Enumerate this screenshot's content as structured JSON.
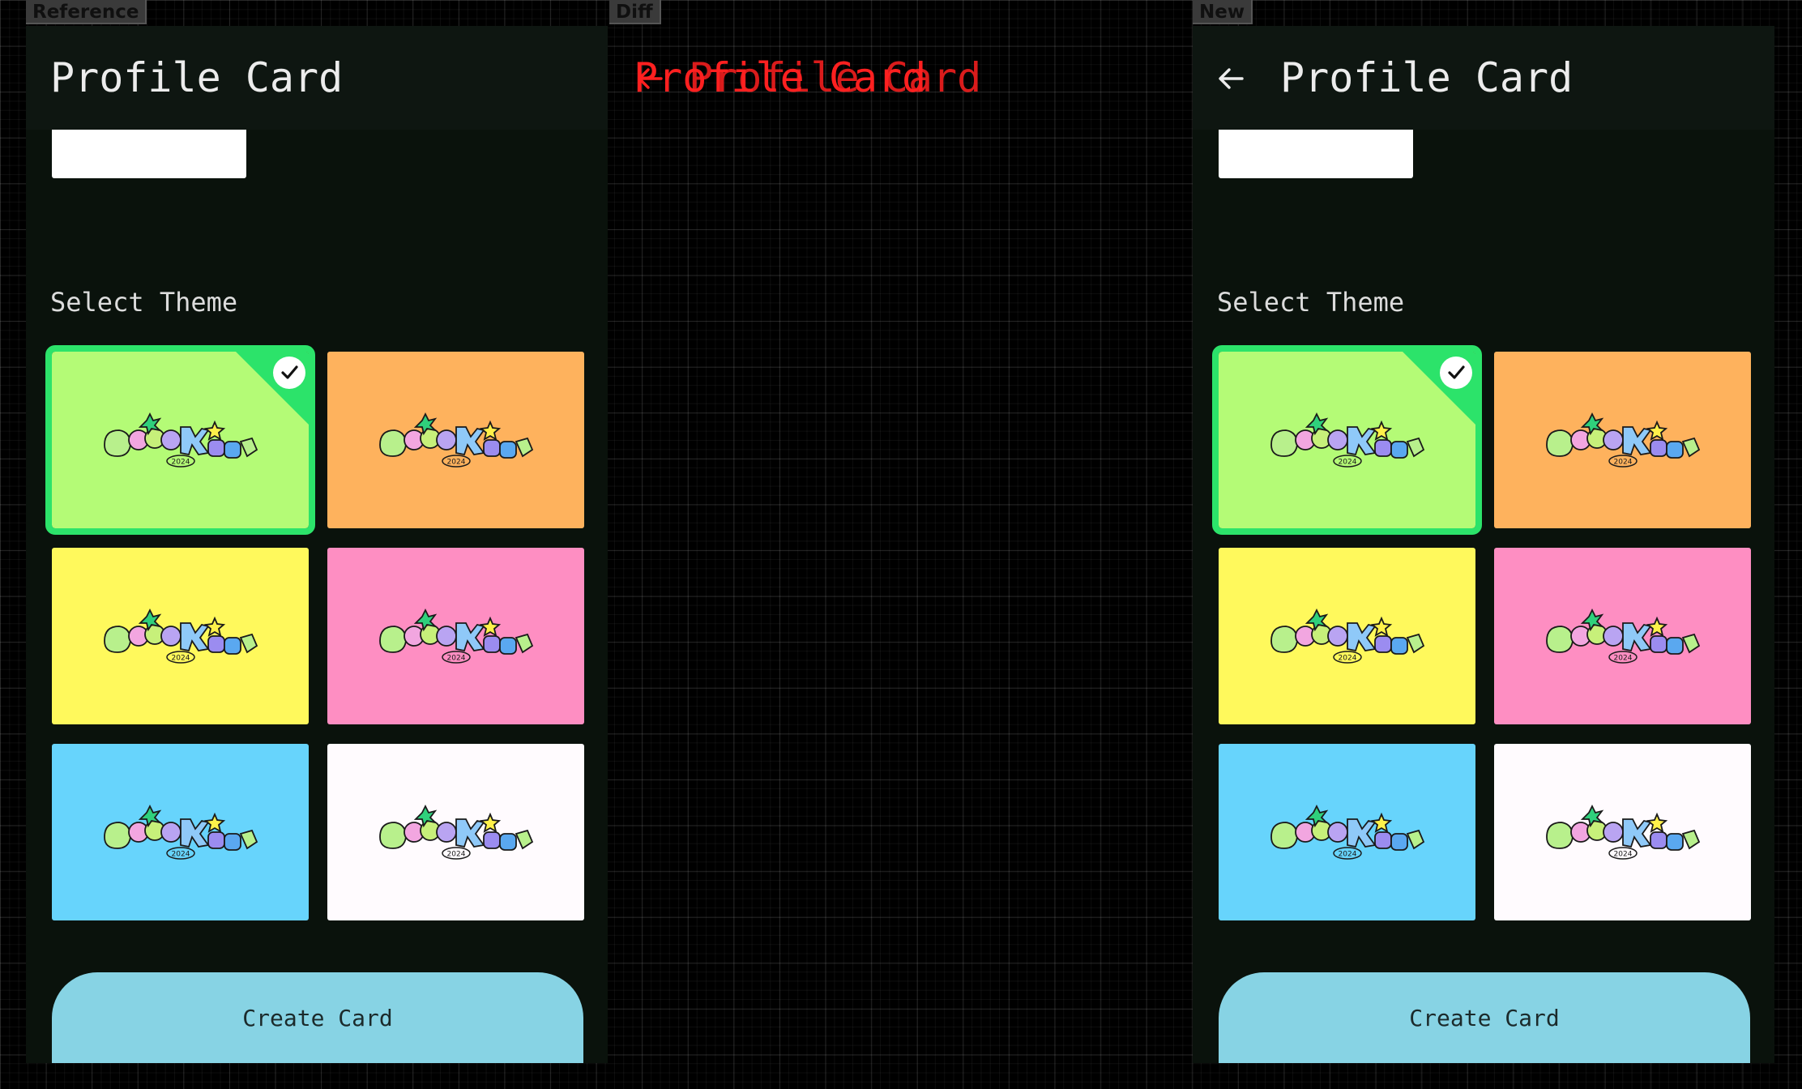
{
  "tags": {
    "reference": "Reference",
    "diff": "Diff",
    "new": "New"
  },
  "app": {
    "title": "Profile Card",
    "name_value": "",
    "section_label": "Select Theme",
    "create_label": "Create Card",
    "logo_year": "2024",
    "selected_theme": "green",
    "themes": [
      {
        "name": "green",
        "color": "#b4fb76"
      },
      {
        "name": "orange",
        "color": "#feb25d"
      },
      {
        "name": "yellow",
        "color": "#fff95c"
      },
      {
        "name": "pink",
        "color": "#fe8ec2"
      },
      {
        "name": "blue",
        "color": "#67d4fc"
      },
      {
        "name": "white",
        "color": "#fffbfe"
      }
    ]
  },
  "colors": {
    "accent": "#2ce36a",
    "button": "#87d3e4",
    "diff": "#ff2020",
    "background": "#0a120c"
  },
  "icons": {
    "back": "arrow-left-icon",
    "check": "checkmark-icon",
    "logo": "droidkaigi-logo"
  }
}
